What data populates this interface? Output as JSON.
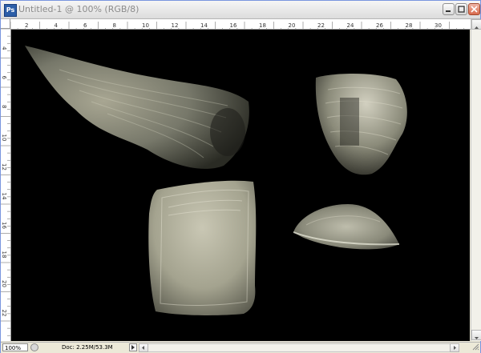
{
  "window": {
    "title": "Untitled-1 @ 100% (RGB/8)",
    "app_icon_label": "Ps"
  },
  "rulers": {
    "top_labels": [
      "2",
      "4",
      "6",
      "8",
      "10",
      "12",
      "14",
      "16",
      "18",
      "20",
      "22",
      "24",
      "26",
      "28",
      "30"
    ],
    "left_labels": [
      "4",
      "6",
      "8",
      "10",
      "12",
      "14",
      "16",
      "18",
      "20",
      "22"
    ]
  },
  "status": {
    "zoom": "100%",
    "doc_info": "Doc: 2.25M/53.3M"
  },
  "colors": {
    "canvas_bg": "#000000",
    "chrome_bg": "#ece9d8",
    "close_button": "#d86a4c"
  },
  "icons": {
    "app": "photoshop-app-icon",
    "minimize": "minimize-icon",
    "maximize": "maximize-icon",
    "close": "close-icon",
    "zoom": "zoom-icon"
  }
}
